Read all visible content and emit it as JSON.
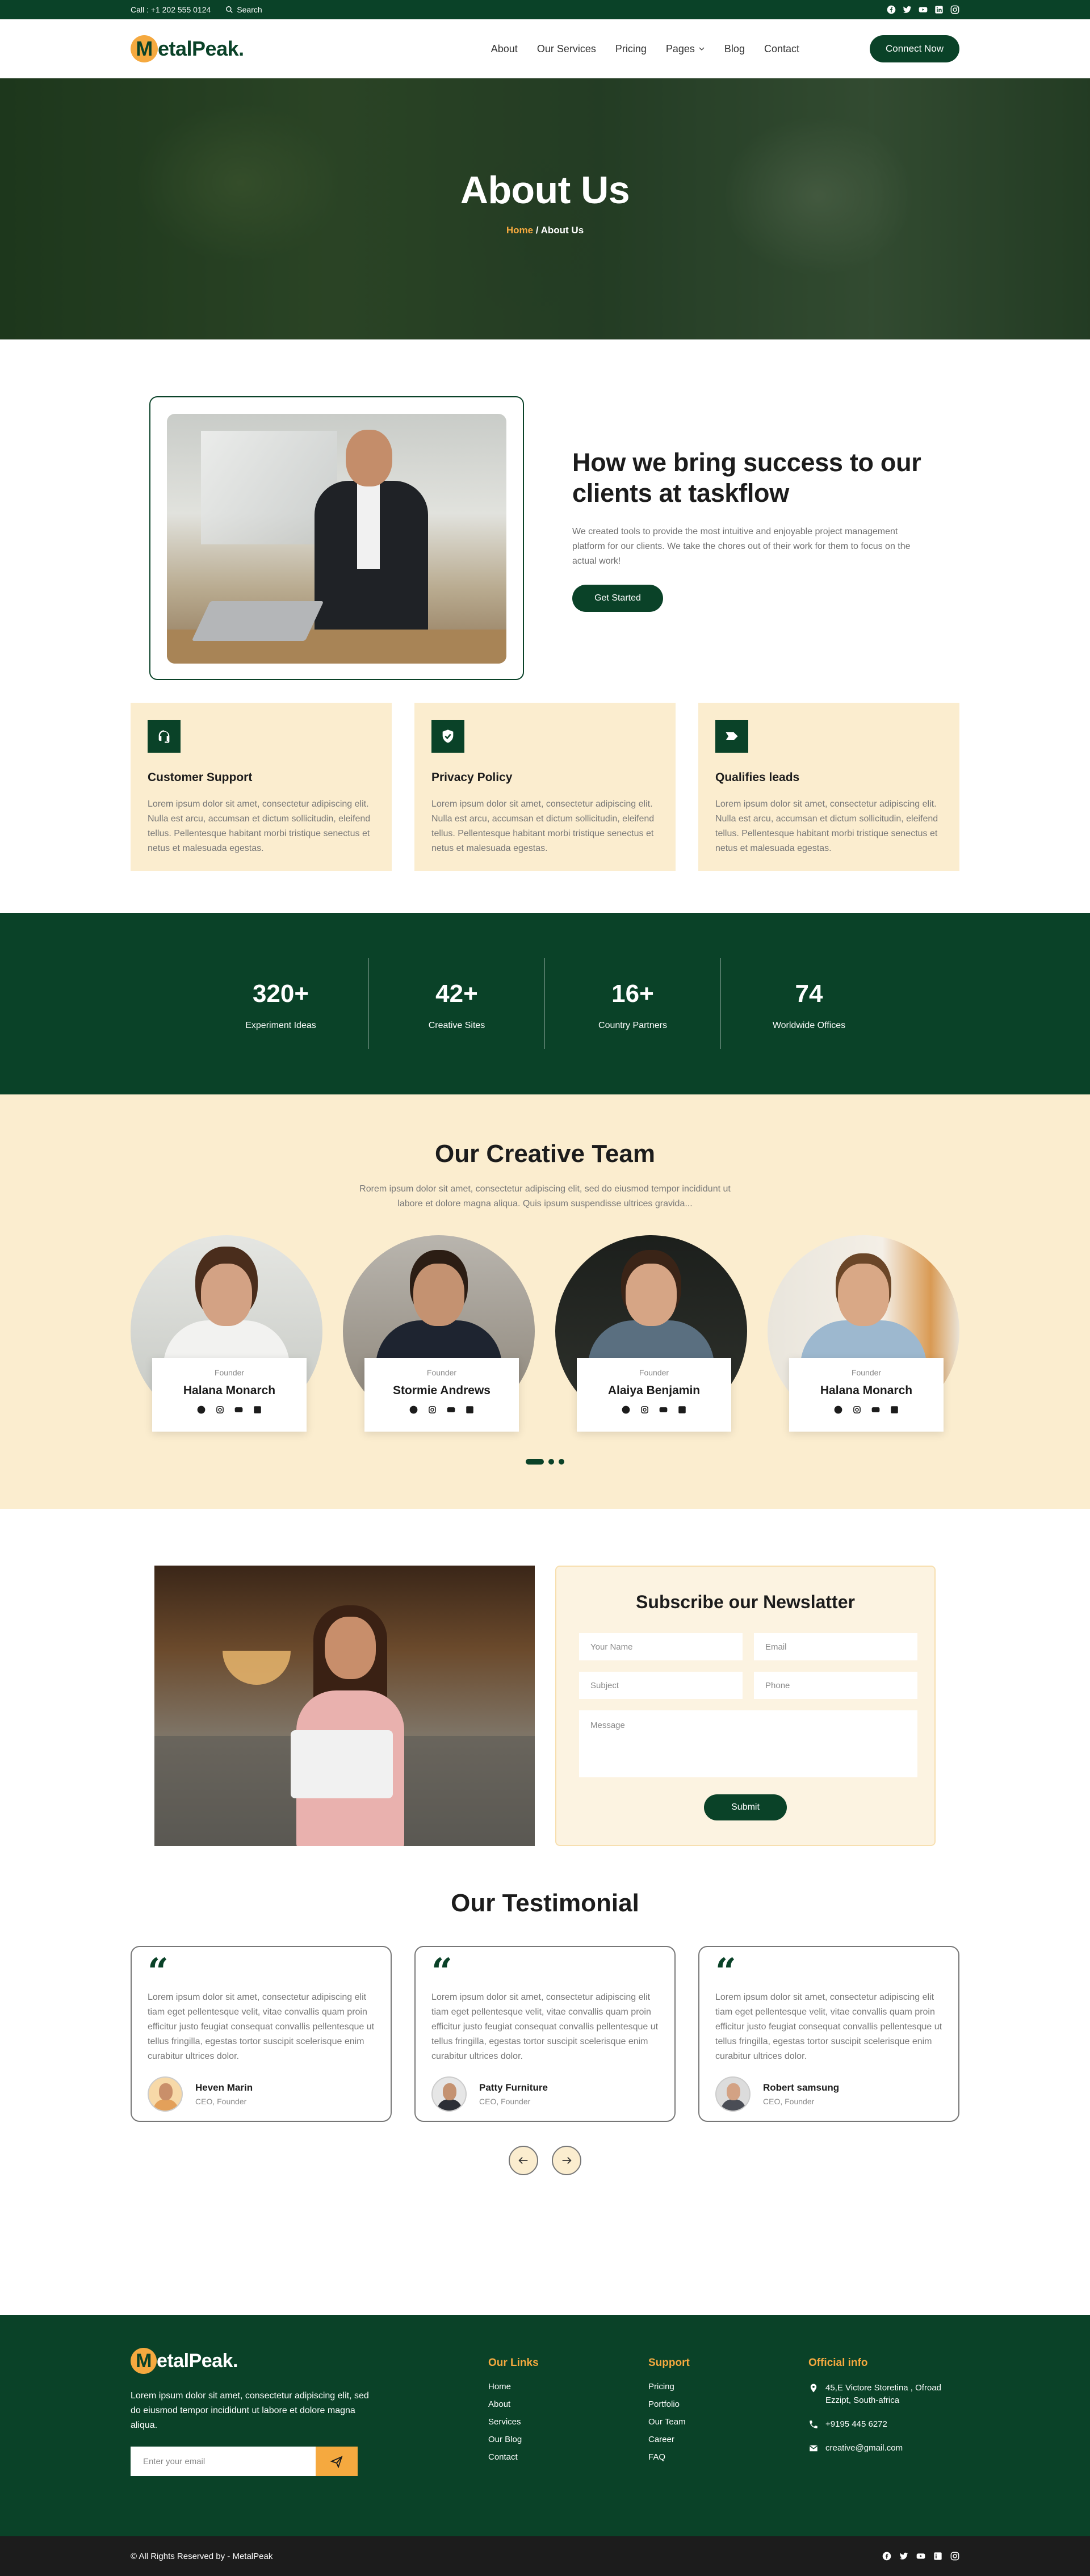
{
  "topbar": {
    "call": "Call : +1 202 555 0124",
    "search_label": "Search",
    "socials": [
      "facebook-icon",
      "twitter-icon",
      "youtube-icon",
      "linkedin-icon",
      "instagram-icon"
    ]
  },
  "header": {
    "logo_letter": "M",
    "logo_rest": "etalPeak.",
    "nav": [
      "About",
      "Our Services",
      "Pricing",
      "Pages",
      "Blog",
      "Contact"
    ],
    "cta": "Connect Now"
  },
  "hero": {
    "title": "About Us",
    "crumb_home": "Home",
    "crumb_sep": " / ",
    "crumb_current": "About Us"
  },
  "about": {
    "title": "How we bring success to our clients at taskflow",
    "body": "We created tools to provide the most intuitive and enjoyable project management platform for our clients. We take the chores out of their work for them to focus on the actual work!",
    "cta": "Get Started"
  },
  "features": [
    {
      "icon": "headset-icon",
      "title": "Customer Support",
      "body": "Lorem ipsum dolor sit amet, consectetur adipiscing elit. Nulla est arcu, accumsan et dictum sollicitudin, eleifend tellus. Pellentesque habitant morbi tristique senectus et netus et malesuada egestas."
    },
    {
      "icon": "shield-icon",
      "title": "Privacy Policy",
      "body": "Lorem ipsum dolor sit amet, consectetur adipiscing elit. Nulla est arcu, accumsan et dictum sollicitudin, eleifend tellus. Pellentesque habitant morbi tristique senectus et netus et malesuada egestas."
    },
    {
      "icon": "tag-icon",
      "title": "Qualifies leads",
      "body": "Lorem ipsum dolor sit amet, consectetur adipiscing elit. Nulla est arcu, accumsan et dictum sollicitudin, eleifend tellus. Pellentesque habitant morbi tristique senectus et netus et malesuada egestas."
    }
  ],
  "stats": [
    {
      "num": "320+",
      "label": "Experiment Ideas"
    },
    {
      "num": "42+",
      "label": "Creative Sites"
    },
    {
      "num": "16+",
      "label": "Country Partners"
    },
    {
      "num": "74",
      "label": "Worldwide Offices"
    }
  ],
  "team": {
    "title": "Our Creative Team",
    "sub": "Rorem ipsum dolor sit amet, consectetur adipiscing elit, sed do eiusmod tempor incididunt ut labore et dolore magna aliqua. Quis ipsum suspendisse ultrices gravida...",
    "members": [
      {
        "role": "Founder",
        "name": "Halana Monarch"
      },
      {
        "role": "Founder",
        "name": "Stormie Andrews"
      },
      {
        "role": "Founder",
        "name": "Alaiya Benjamin"
      },
      {
        "role": "Founder",
        "name": "Halana Monarch"
      }
    ],
    "member_socials": [
      "facebook-icon",
      "instagram-icon",
      "youtube-icon",
      "linkedin-icon"
    ],
    "slide_count": 3,
    "active_slide": 1
  },
  "newsletter": {
    "title": "Subscribe our Newslatter",
    "name_ph": "Your Name",
    "email_ph": "Email",
    "subject_ph": "Subject",
    "phone_ph": "Phone",
    "message_ph": "Message",
    "submit": "Submit"
  },
  "testimonial": {
    "title": "Our Testimonial",
    "items": [
      {
        "body": "Lorem ipsum dolor sit amet, consectetur adipiscing elit tiam eget pellentesque velit, vitae convallis quam proin efficitur justo feugiat consequat convallis pellentesque ut tellus fringilla, egestas tortor suscipit scelerisque enim curabitur ultrices dolor.",
        "name": "Heven Marin",
        "role": "CEO, Founder"
      },
      {
        "body": "Lorem ipsum dolor sit amet, consectetur adipiscing elit tiam eget pellentesque velit, vitae convallis quam proin efficitur justo feugiat consequat convallis pellentesque ut tellus fringilla, egestas tortor suscipit scelerisque enim curabitur ultrices dolor.",
        "name": "Patty Furniture",
        "role": "CEO, Founder"
      },
      {
        "body": "Lorem ipsum dolor sit amet, consectetur adipiscing elit tiam eget pellentesque velit, vitae convallis quam proin efficitur justo feugiat consequat convallis pellentesque ut tellus fringilla, egestas tortor suscipit scelerisque enim curabitur ultrices dolor.",
        "name": "Robert samsung",
        "role": "CEO, Founder"
      }
    ]
  },
  "footer": {
    "about": "Lorem ipsum dolor sit amet, consectetur adipiscing elit, sed do eiusmod tempor incididunt ut labore et dolore magna aliqua.",
    "email_ph": "Enter your email",
    "links_title": "Our Links",
    "links": [
      "Home",
      "About",
      "Services",
      "Our Blog",
      "Contact"
    ],
    "support_title": "Support",
    "support": [
      "Pricing",
      "Portfolio",
      "Our Team",
      "Career",
      "FAQ"
    ],
    "info_title": "Official info",
    "address": "45,E Victore Storetina , Ofroad Ezzipt, South-africa",
    "phone": "+9195 445 6272",
    "email": "creative@gmail.com",
    "copyright": "© All Rights Reserved by - MetalPeak"
  },
  "colors": {
    "brand_green": "#0a4228",
    "accent_orange": "#f5a93f",
    "cream": "#fbedcf"
  }
}
